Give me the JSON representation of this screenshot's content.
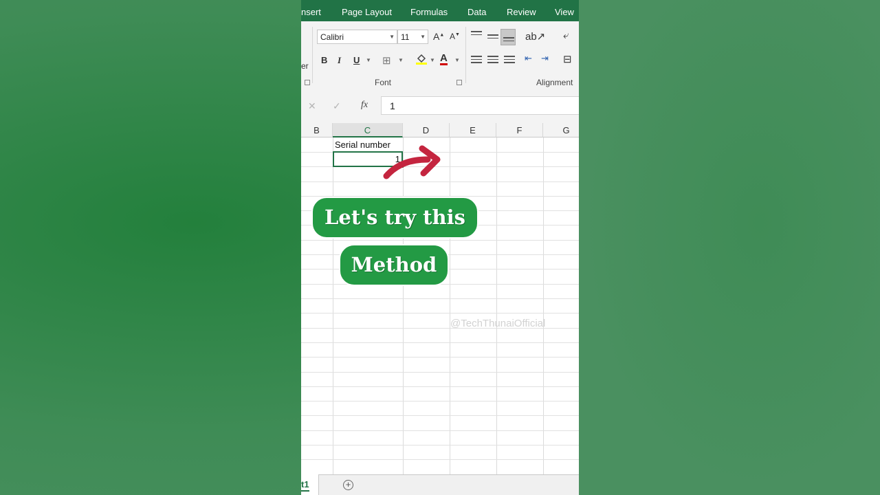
{
  "ribbon_tabs": [
    "nsert",
    "Page Layout",
    "Formulas",
    "Data",
    "Review",
    "View"
  ],
  "ribbon": {
    "left_clipped_text": "er",
    "font_name": "Calibri",
    "font_size": "11",
    "grow_font": "A",
    "shrink_font": "A",
    "bold": "B",
    "italic": "I",
    "underline": "U",
    "font_color_glyph": "A",
    "font_group_label": "Font",
    "alignment_group_label": "Alignment"
  },
  "formula_bar": {
    "cancel_glyph": "✕",
    "enter_glyph": "✓",
    "fx_label": "fx",
    "value": "1"
  },
  "columns": [
    "B",
    "C",
    "D",
    "E",
    "F",
    "G"
  ],
  "cells": {
    "c1": "Serial number",
    "c2": "1"
  },
  "watermark": "@TechThunaiOfficial",
  "overlay": {
    "line1": "Let's try this",
    "line2": "Method"
  },
  "sheet_tab_label": "t1",
  "add_sheet_glyph": "+",
  "colors": {
    "excel_green": "#217346",
    "pill_green": "#239a44",
    "arrow_red": "#c4253f"
  }
}
